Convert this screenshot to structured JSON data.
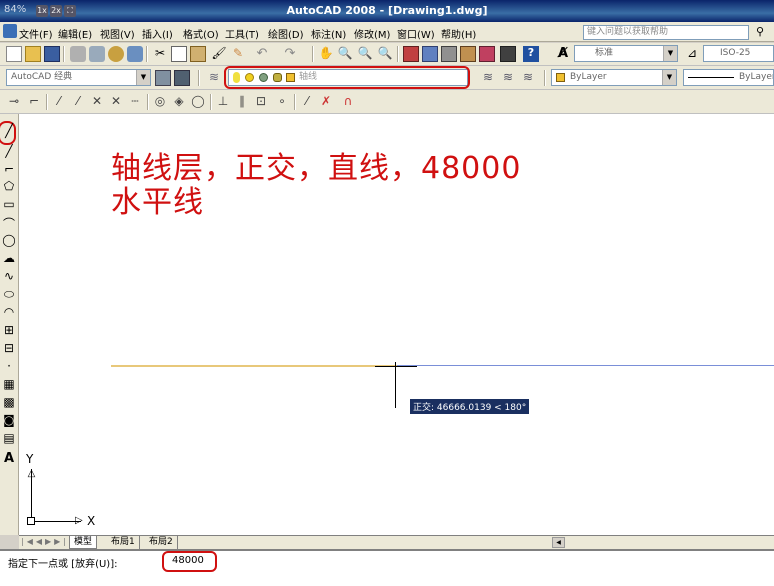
{
  "window": {
    "title": "AutoCAD 2008 - [Drawing1.dwg]",
    "zoom_pct": "84%",
    "zoom_1x": "1x",
    "zoom_2x": "2x",
    "colors": {
      "titlebar": "#0a246a",
      "annotation_red": "#d01010",
      "axis_line_yellow": "#e8c87a",
      "axis_line_blue": "#7a8fd8"
    }
  },
  "menu": {
    "items": [
      "文件(F)",
      "编辑(E)",
      "视图(V)",
      "插入(I)",
      "格式(O)",
      "工具(T)",
      "绘图(D)",
      "标注(N)",
      "修改(M)",
      "窗口(W)",
      "帮助(H)"
    ],
    "help_placeholder": "键入问题以获取帮助"
  },
  "toolbar": {
    "workspace": "AutoCAD 经典",
    "layer_name": "轴线",
    "text_style": "标准",
    "dim_style": "ISO-25",
    "color": "ByLayer",
    "linetype": "ByLayer"
  },
  "annotation": {
    "line1": "轴线层，正交，直线，48000",
    "line2": "水平线"
  },
  "cursor": {
    "tooltip": "正交: 46666.0139 < 180°"
  },
  "ucs": {
    "x_label": "X",
    "y_label": "Y"
  },
  "tabs": {
    "model": "模型",
    "layout1": "布局1",
    "layout2": "布局2"
  },
  "command": {
    "prompt": "指定下一点或 [放弃(U)]:",
    "input_value": "48000"
  }
}
